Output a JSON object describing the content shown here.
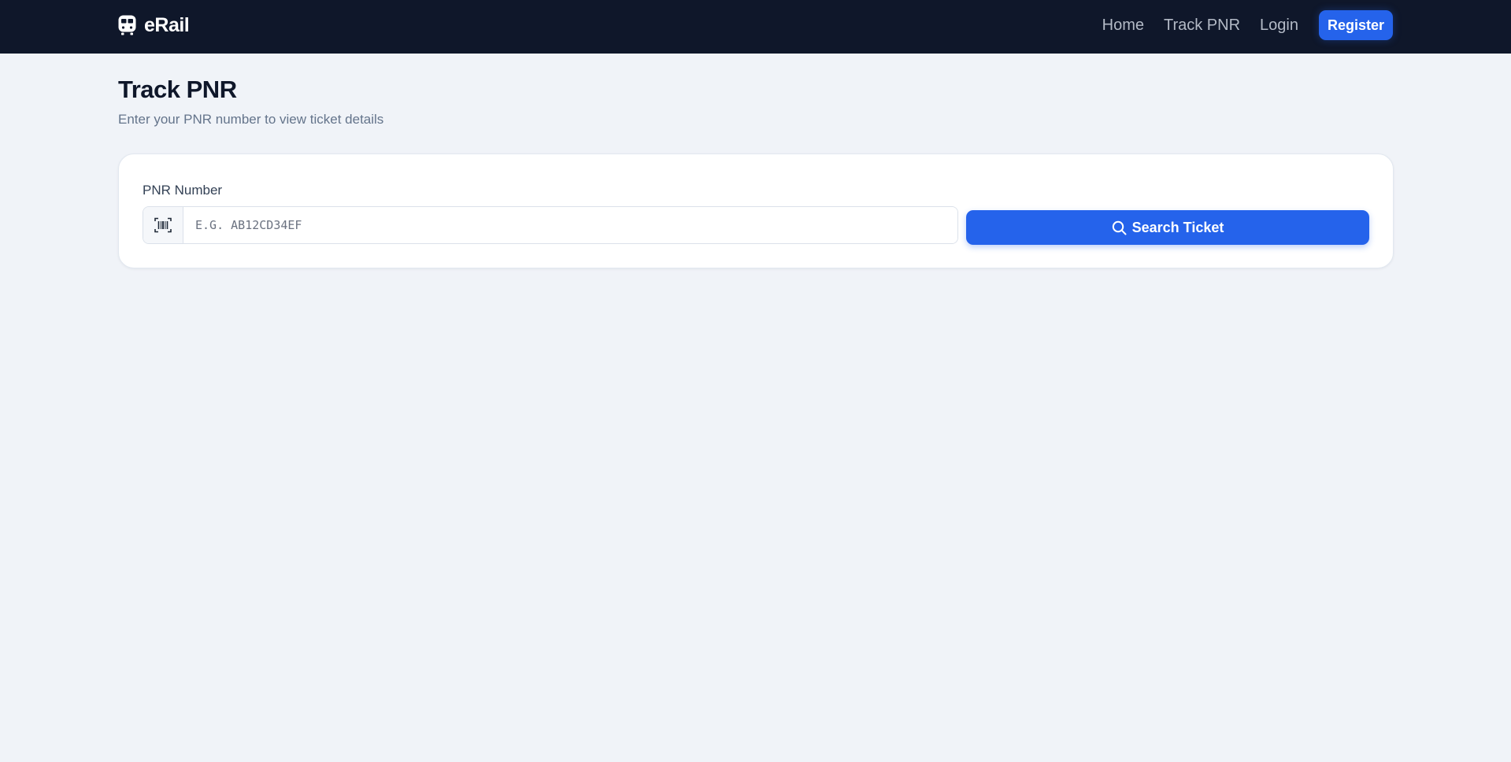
{
  "navbar": {
    "brand": "eRail",
    "brand_icon": "train-icon",
    "links": [
      "Home",
      "Track PNR",
      "Login"
    ],
    "register_label": "Register",
    "background": "#0f172a"
  },
  "page": {
    "title": "Track PNR",
    "subtitle": "Enter your PNR number to view ticket details"
  },
  "form": {
    "label": "PNR Number",
    "input_icon": "barcode-scan-icon",
    "input_placeholder": "E.G. AB12CD34EF",
    "input_value": "",
    "button_icon": "search-icon",
    "button_label": "Search Ticket",
    "accent": "#2563eb"
  }
}
